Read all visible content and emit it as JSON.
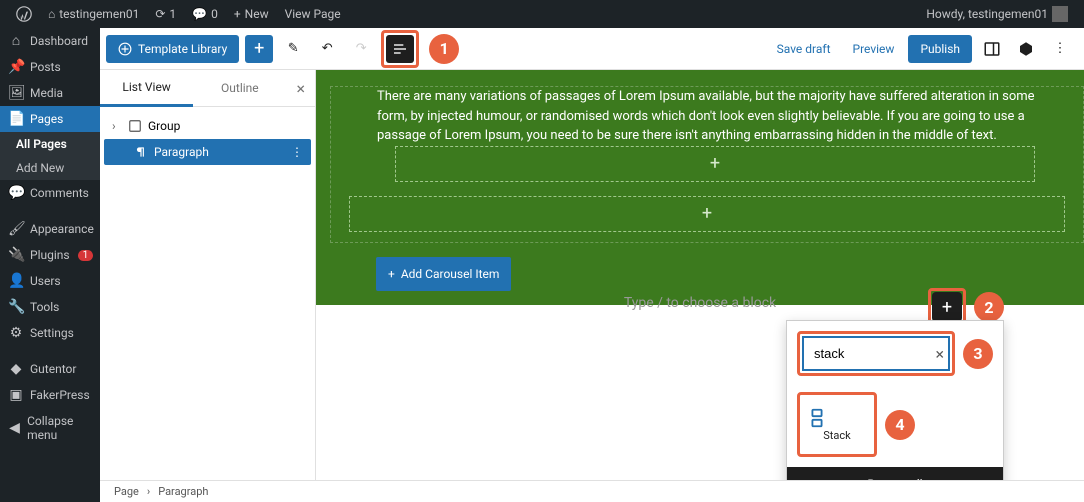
{
  "adminbar": {
    "site": "testingemen01",
    "updates": "1",
    "comments": "0",
    "new": "New",
    "viewpage": "View Page",
    "howdy": "Howdy, testingemen01"
  },
  "adminmenu": {
    "items": [
      {
        "icon": "dash",
        "label": "Dashboard"
      },
      {
        "icon": "pin",
        "label": "Posts"
      },
      {
        "icon": "media",
        "label": "Media"
      },
      {
        "icon": "page",
        "label": "Pages",
        "current": true,
        "sub": [
          {
            "label": "All Pages",
            "current": true
          },
          {
            "label": "Add New"
          }
        ]
      },
      {
        "icon": "comment",
        "label": "Comments"
      },
      {
        "icon": "appear",
        "label": "Appearance"
      },
      {
        "icon": "plugin",
        "label": "Plugins",
        "badge": "1"
      },
      {
        "icon": "user",
        "label": "Users"
      },
      {
        "icon": "tool",
        "label": "Tools"
      },
      {
        "icon": "setting",
        "label": "Settings"
      },
      {
        "icon": "gutentor",
        "label": "Gutentor"
      },
      {
        "icon": "faker",
        "label": "FakerPress"
      },
      {
        "icon": "collapse",
        "label": "Collapse menu"
      }
    ]
  },
  "topbar": {
    "library": "Template Library",
    "save_draft": "Save draft",
    "preview": "Preview",
    "publish": "Publish"
  },
  "panel": {
    "tab_list": "List View",
    "tab_outline": "Outline",
    "tree": {
      "group": "Group",
      "paragraph": "Paragraph"
    }
  },
  "canvas": {
    "lorem": "There are many variations of passages of Lorem Ipsum available, but the majority have suffered alteration in some form, by injected humour, or randomised words which don't look even slightly believable. If you are going to use a passage of Lorem Ipsum, you need to be sure there isn't anything embarrassing hidden in the middle of text.",
    "add_carousel": "Add Carousel Item",
    "placeholder": "Type / to choose a block"
  },
  "inserter": {
    "search_value": "stack",
    "result_label": "Stack",
    "browse_all": "Browse all"
  },
  "breadcrumb": {
    "a": "Page",
    "b": "Paragraph"
  },
  "callouts": {
    "c1": "1",
    "c2": "2",
    "c3": "3",
    "c4": "4"
  }
}
